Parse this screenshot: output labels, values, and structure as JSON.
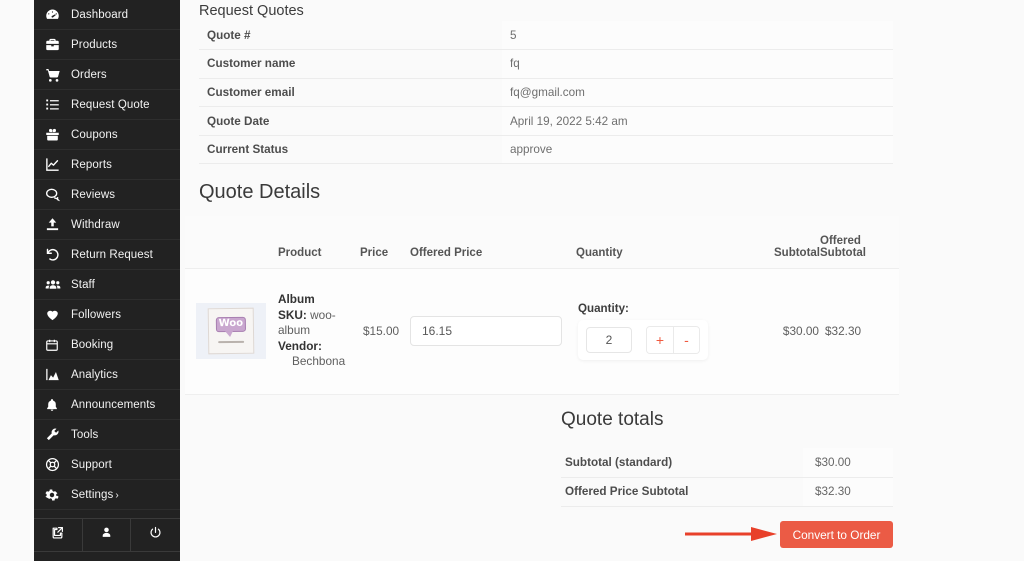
{
  "sidebar": {
    "items": [
      {
        "label": "Dashboard",
        "icon": "speedometer-icon"
      },
      {
        "label": "Products",
        "icon": "briefcase-icon"
      },
      {
        "label": "Orders",
        "icon": "shopping-cart-icon"
      },
      {
        "label": "Request Quote",
        "icon": "list-icon"
      },
      {
        "label": "Coupons",
        "icon": "gift-icon"
      },
      {
        "label": "Reports",
        "icon": "chart-line-icon"
      },
      {
        "label": "Reviews",
        "icon": "comments-icon"
      },
      {
        "label": "Withdraw",
        "icon": "upload-icon"
      },
      {
        "label": "Return Request",
        "icon": "undo-icon"
      },
      {
        "label": "Staff",
        "icon": "users-icon"
      },
      {
        "label": "Followers",
        "icon": "heart-icon"
      },
      {
        "label": "Booking",
        "icon": "calendar-icon"
      },
      {
        "label": "Analytics",
        "icon": "chart-area-icon"
      },
      {
        "label": "Announcements",
        "icon": "bell-icon"
      },
      {
        "label": "Tools",
        "icon": "wrench-icon"
      },
      {
        "label": "Support",
        "icon": "lifebuoy-icon"
      },
      {
        "label": "Settings",
        "icon": "gear-icon",
        "chevron": "›"
      }
    ],
    "footer": [
      {
        "name": "visit-store-button",
        "icon": "external-link-icon"
      },
      {
        "name": "account-button",
        "icon": "user-icon"
      },
      {
        "name": "logout-button",
        "icon": "power-icon"
      }
    ]
  },
  "page": {
    "title": "Request Quotes",
    "details_heading": "Quote Details",
    "totals_heading": "Quote totals"
  },
  "info": {
    "rows": [
      {
        "key": "Quote #",
        "value": "5"
      },
      {
        "key": "Customer name",
        "value": "fq"
      },
      {
        "key": "Customer email",
        "value": "fq@gmail.com"
      },
      {
        "key": "Quote Date",
        "value": "April 19, 2022 5:42 am"
      },
      {
        "key": "Current Status",
        "value": "approve"
      }
    ]
  },
  "details": {
    "headers": {
      "thumb": "",
      "product": "Product",
      "price": "Price",
      "offered_price": "Offered Price",
      "quantity": "Quantity",
      "subtotal": "Subtotal",
      "offered_subtotal_line1": "Offered",
      "offered_subtotal_line2": "Subtotal"
    },
    "row": {
      "thumb_alt": "woo-album-thumbnail",
      "thumb_text": "Woo",
      "product_name": "Album",
      "sku_label": "SKU:",
      "sku_value": "woo-album",
      "vendor_label": "Vendor:",
      "vendor_value": "Bechbona",
      "price": "$15.00",
      "offered_price_value": "16.15",
      "offered_price_placeholder": "",
      "quantity_label": "Quantity:",
      "quantity_value": "2",
      "increase_label": "+",
      "decrease_label": "-",
      "subtotal": "$30.00",
      "offered_subtotal": "$32.30"
    }
  },
  "totals": {
    "rows": [
      {
        "label": "Subtotal (standard)",
        "value": "$30.00"
      },
      {
        "label": "Offered Price Subtotal",
        "value": "$32.30"
      }
    ]
  },
  "actions": {
    "convert_label": "Convert to Order"
  },
  "colors": {
    "sidebar_bg": "#222222",
    "accent_red": "#eb5b45",
    "stepper_red": "#f05a3f",
    "annotation_red": "#e8402a",
    "page_bg": "#fafafa",
    "table_bg": "#fdfdfd",
    "border": "#ececec"
  }
}
